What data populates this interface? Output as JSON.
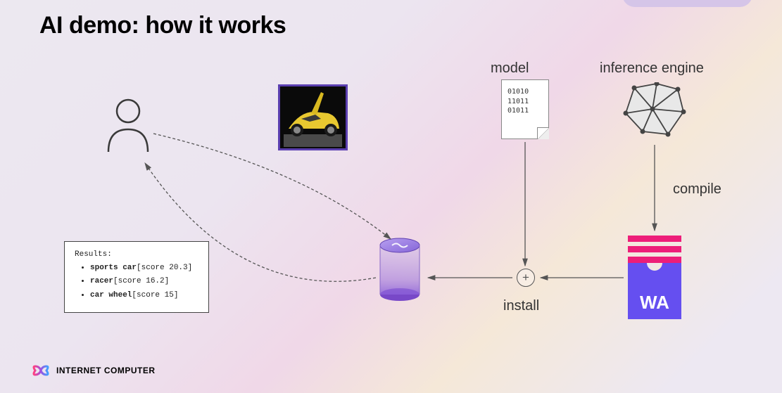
{
  "title": "AI demo: how it works",
  "labels": {
    "model": "model",
    "inference_engine": "inference engine",
    "compile": "compile",
    "install": "install"
  },
  "model_file": {
    "line1": "01010",
    "line2": "11011",
    "line3": "01011"
  },
  "wa_label": "WA",
  "plus_symbol": "+",
  "results": {
    "header": "Results:",
    "items": [
      {
        "label": "sports car",
        "score_text": "[score 20.3]",
        "score": 20.3
      },
      {
        "label": "racer",
        "score_text": "[score 16.2]",
        "score": 16.2
      },
      {
        "label": "car wheel",
        "score_text": "[score 15]",
        "score": 15
      }
    ]
  },
  "footer": {
    "brand": "INTERNET COMPUTER"
  }
}
